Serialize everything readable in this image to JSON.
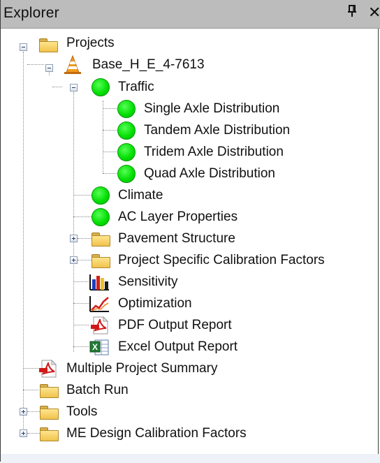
{
  "window": {
    "title": "Explorer",
    "pin_glyph": "Ѱ",
    "close_glyph": "✕"
  },
  "tree": {
    "projects_label": "Projects",
    "project_name": "Base_H_E_4-7613",
    "traffic_label": "Traffic",
    "traffic_children": [
      "Single Axle Distribution",
      "Tandem Axle Distribution",
      "Tridem Axle Distribution",
      "Quad Axle Distribution"
    ],
    "climate_label": "Climate",
    "ac_layer_label": "AC Layer Properties",
    "pavement_label": "Pavement Structure",
    "calibration_label": "Project Specific Calibration Factors",
    "sensitivity_label": "Sensitivity",
    "optimization_label": "Optimization",
    "pdf_report_label": "PDF Output Report",
    "excel_report_label": "Excel Output Report",
    "multi_summary_label": "Multiple Project Summary",
    "batch_run_label": "Batch Run",
    "tools_label": "Tools",
    "me_design_label": "ME Design Calibration Factors"
  },
  "icons": {
    "folder": "folder-icon",
    "status_ok": "green-status-icon",
    "project": "cone-icon",
    "pdf": "pdf-icon",
    "sensitivity": "bar-chart-icon",
    "optimization": "line-chart-icon",
    "excel": "excel-icon"
  },
  "colors": {
    "status_green": "#00dd00",
    "title_bar": "#bcbcbc",
    "folder_yellow": "#f0c24c"
  }
}
